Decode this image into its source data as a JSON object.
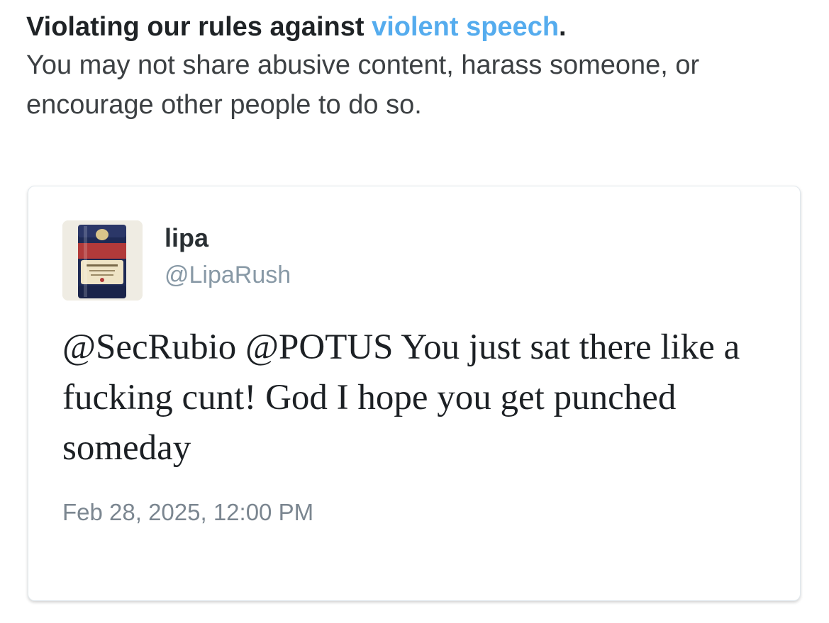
{
  "notice": {
    "heading_prefix": "Violating our rules against ",
    "heading_link": "violent speech",
    "heading_suffix": ".",
    "body": "You may not share abusive content, harass someone, or encourage other people to do so.",
    "link_color": "#55acee"
  },
  "tweet": {
    "avatar": {
      "icon": "beer-can-avatar-icon",
      "brand_text": "ARBOGA"
    },
    "author_name": "lipa",
    "author_handle": "@LipaRush",
    "text": "@SecRubio @POTUS You just sat there like a fucking cunt! God I hope you get punched someday",
    "timestamp": "Feb 28, 2025, 12:00 PM"
  }
}
